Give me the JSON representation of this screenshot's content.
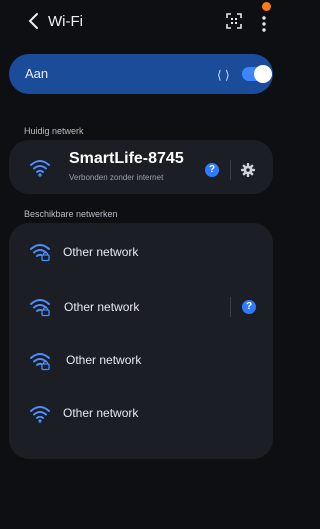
{
  "header": {
    "title": "Wi-Fi"
  },
  "master_switch": {
    "label": "Aan",
    "enabled": true,
    "progress_text": "⟨ ⟩"
  },
  "current_section": {
    "label": "Huidig netwerk",
    "network": {
      "name": "SmartLife-8745",
      "status": "Verbonden zonder internet",
      "help_label": "?"
    }
  },
  "available_section": {
    "label": "Beschikbare netwerken",
    "networks": [
      {
        "name": "Other network",
        "secured": true
      },
      {
        "name": "Other network",
        "secured": true,
        "help_label": "?"
      },
      {
        "name": "Other network",
        "secured": true
      },
      {
        "name": "Other network",
        "secured": false
      }
    ]
  },
  "colors": {
    "accent": "#2f7bff",
    "master_bg": "#1a4c9a",
    "card_bg": "#1b1e24",
    "page_bg": "#0d0f12",
    "notification": "#ff7a1a"
  },
  "icons": [
    "back-chevron-icon",
    "qr-scan-icon",
    "more-vertical-icon",
    "wifi-icon",
    "wifi-lock-icon",
    "gear-icon",
    "help-icon"
  ]
}
